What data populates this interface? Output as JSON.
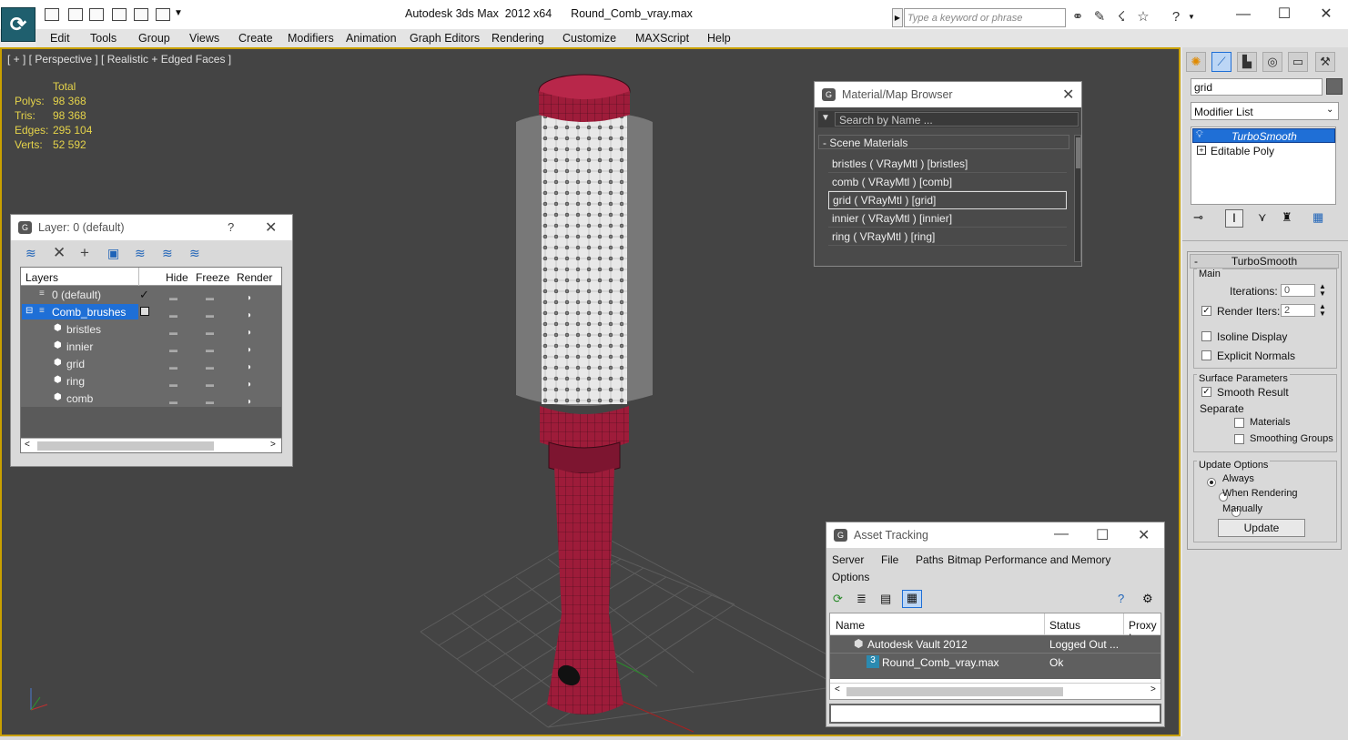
{
  "title": {
    "app": "Autodesk 3ds Max  2012 x64",
    "file": "Round_Comb_vray.max"
  },
  "search": {
    "placeholder": "Type a keyword or phrase"
  },
  "menu": [
    "Edit",
    "Tools",
    "Group",
    "Views",
    "Create",
    "Modifiers",
    "Animation",
    "Graph Editors",
    "Rendering",
    "Customize",
    "MAXScript",
    "Help"
  ],
  "viewport": {
    "label": "[ + ] [ Perspective ] [ Realistic + Edged Faces ]",
    "stats": {
      "header": "Total",
      "rows": [
        {
          "label": "Polys:",
          "value": "98 368"
        },
        {
          "label": "Tris:",
          "value": "98 368"
        },
        {
          "label": "Edges:",
          "value": "295 104"
        },
        {
          "label": "Verts:",
          "value": "52 592"
        }
      ]
    }
  },
  "layer_panel": {
    "title": "Layer: 0 (default)",
    "help": "?",
    "columns": [
      "Layers",
      "Hide",
      "Freeze",
      "Render"
    ],
    "rows": [
      {
        "name": "0 (default)"
      },
      {
        "name": "Comb_brushes"
      },
      {
        "name": "bristles"
      },
      {
        "name": "innier"
      },
      {
        "name": "grid"
      },
      {
        "name": "ring"
      },
      {
        "name": "comb"
      }
    ]
  },
  "material_browser": {
    "title": "Material/Map Browser",
    "search_placeholder": "Search by Name ...",
    "group": "- Scene Materials",
    "items": [
      "bristles  ( VRayMtl ) [bristles]",
      "comb  ( VRayMtl ) [comb]",
      "grid  ( VRayMtl ) [grid]",
      "innier  ( VRayMtl ) [innier]",
      "ring  ( VRayMtl ) [ring]"
    ]
  },
  "asset_tracking": {
    "title": "Asset Tracking",
    "menu": [
      "Server",
      "File",
      "Paths",
      "Bitmap Performance and Memory",
      "Options"
    ],
    "columns": [
      "Name",
      "Status",
      "Proxy I"
    ],
    "rows": [
      {
        "name": "Autodesk Vault 2012",
        "status": "Logged Out ..."
      },
      {
        "name": "Round_Comb_vray.max",
        "status": "Ok"
      }
    ]
  },
  "command_panel": {
    "object_name": "grid",
    "modifier_list": "Modifier List",
    "stack": [
      "TurboSmooth",
      "Editable Poly"
    ],
    "rollout": {
      "title": "TurboSmooth",
      "main_label": "Main",
      "iterations_label": "Iterations:",
      "iterations_value": "0",
      "render_iters_label": "Render Iters:",
      "render_iters_value": "2",
      "isoline": "Isoline Display",
      "explicit": "Explicit Normals",
      "surface_label": "Surface Parameters",
      "smooth_result": "Smooth Result",
      "separate_label": "Separate",
      "materials": "Materials",
      "smoothing_groups": "Smoothing Groups",
      "update_label": "Update Options",
      "always": "Always",
      "when_rendering": "When Rendering",
      "manually": "Manually",
      "update_button": "Update"
    }
  },
  "colors": {
    "accent": "#c9a000",
    "selection": "#1f6fd6",
    "brush": "#9e1c3a"
  }
}
